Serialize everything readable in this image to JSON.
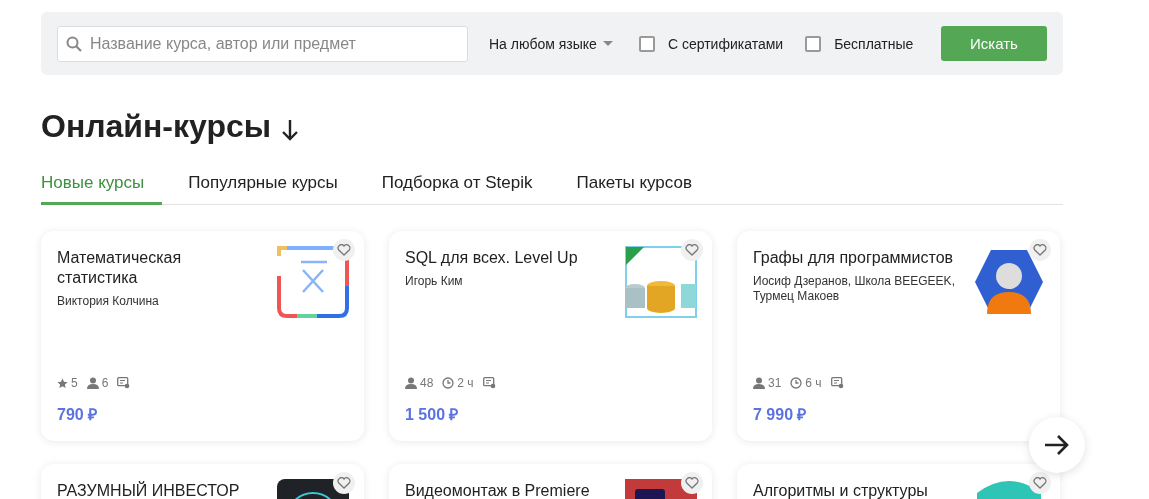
{
  "search": {
    "placeholder": "Название курса, автор или предмет",
    "language": "На любом языке",
    "filters": [
      {
        "label": "С сертификатами",
        "checked": false
      },
      {
        "label": "Бесплатные",
        "checked": false
      }
    ],
    "button": "Искать"
  },
  "heading": "Онлайн-курсы",
  "tabs": [
    {
      "label": "Новые курсы",
      "selected": true
    },
    {
      "label": "Популярные курсы",
      "selected": false
    },
    {
      "label": "Подборка от Stepik",
      "selected": false
    },
    {
      "label": "Пакеты курсов",
      "selected": false
    }
  ],
  "courses": [
    {
      "title": "Математическая статистика",
      "authors": "Виктория Колчина",
      "cover": {
        "kind": "math"
      },
      "stats": [
        {
          "kind": "rating",
          "value": "5"
        },
        {
          "kind": "learners",
          "value": "6"
        },
        {
          "kind": "certificate"
        }
      ],
      "price": "790 ₽"
    },
    {
      "title": "SQL для всех. Level Up",
      "authors": "Игорь Ким",
      "cover": {
        "kind": "database"
      },
      "stats": [
        {
          "kind": "learners",
          "value": "48"
        },
        {
          "kind": "hours",
          "value": "2 ч"
        },
        {
          "kind": "certificate"
        }
      ],
      "price": "1 500 ₽"
    },
    {
      "title": "Графы для программистов",
      "authors": "Иосиф Дзеранов, Школа BEEGEEK, Турмец Макоев",
      "cover": {
        "kind": "avatar"
      },
      "stats": [
        {
          "kind": "learners",
          "value": "31"
        },
        {
          "kind": "hours",
          "value": "6 ч"
        },
        {
          "kind": "certificate"
        }
      ],
      "price": "7 990 ₽"
    },
    {
      "title": "РАЗУМНЫЙ ИНВЕСТОР",
      "cover": {
        "kind": "ring"
      }
    },
    {
      "title": "Видеомонтаж в Premiere",
      "cover": {
        "kind": "video"
      }
    },
    {
      "title": "Алгоритмы и структуры",
      "cover": {
        "kind": "teal"
      }
    }
  ]
}
